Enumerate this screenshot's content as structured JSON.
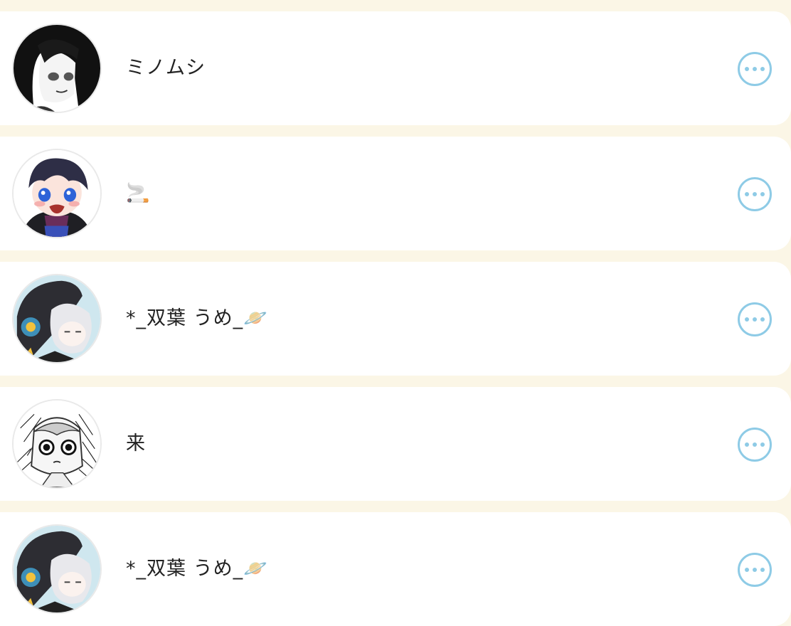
{
  "users": [
    {
      "name": "ミノムシ",
      "avatar": "manga-girl-avatar",
      "more_icon": "more-options-icon"
    },
    {
      "name": "🚬",
      "avatar": "blue-eyed-boy-avatar",
      "more_icon": "more-options-icon"
    },
    {
      "name": "*_双葉 うめ_🪐",
      "avatar": "hooded-girl-avatar",
      "more_icon": "more-options-icon"
    },
    {
      "name": "来",
      "avatar": "sketch-girl-avatar",
      "more_icon": "more-options-icon"
    },
    {
      "name": "*_双葉 うめ_🪐",
      "avatar": "hooded-girl-avatar",
      "more_icon": "more-options-icon"
    }
  ],
  "colors": {
    "background": "#fbf6e6",
    "card": "#ffffff",
    "accent": "#8ecbe6",
    "text": "#222222"
  }
}
